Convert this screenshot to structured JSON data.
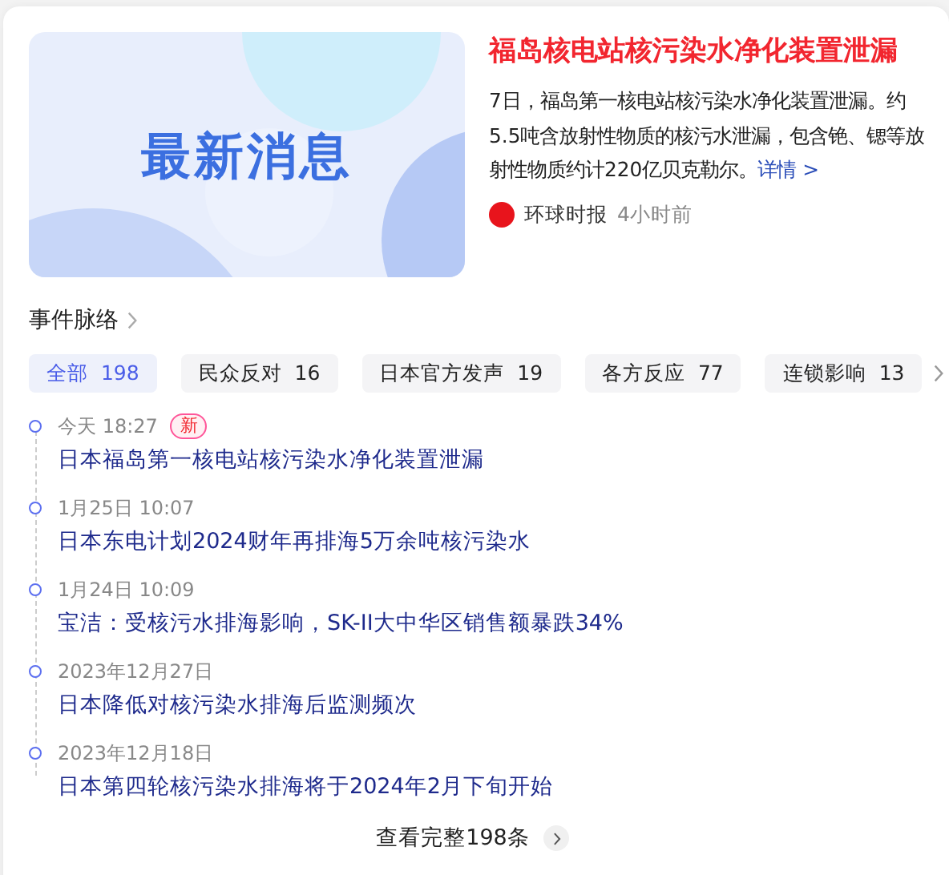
{
  "headline": {
    "banner_text": "最新消息",
    "title": "福岛核电站核污染水净化装置泄漏",
    "summary": "7日，福岛第一核电站核污染水净化装置泄漏。约5.5吨含放射性物质的核污水泄漏，包含铯、锶等放射性物质约计220亿贝克勒尔。",
    "more_link": "详情 >",
    "source": "环球时报",
    "time": "4小时前"
  },
  "timeline": {
    "title": "事件脉络",
    "tabs": [
      {
        "label": "全部",
        "count": "198",
        "selected": true
      },
      {
        "label": "民众反对",
        "count": "16",
        "selected": false
      },
      {
        "label": "日本官方发声",
        "count": "19",
        "selected": false
      },
      {
        "label": "各方反应",
        "count": "77",
        "selected": false
      },
      {
        "label": "连锁影响",
        "count": "13",
        "selected": false
      }
    ],
    "events": [
      {
        "date": "今天 18:27",
        "badge": "新",
        "title": "日本福岛第一核电站核污染水净化装置泄漏"
      },
      {
        "date": "1月25日 10:07",
        "title": "日本东电计划2024财年再排海5万余吨核污染水"
      },
      {
        "date": "1月24日 10:09",
        "title": "宝洁：受核污水排海影响，SK-II大中华区销售额暴跌34%"
      },
      {
        "date": "2023年12月27日",
        "title": "日本降低对核污染水排海后监测频次"
      },
      {
        "date": "2023年12月18日",
        "title": "日本第四轮核污染水排海将于2024年2月下旬开始"
      }
    ],
    "view_all": "查看完整198条"
  }
}
